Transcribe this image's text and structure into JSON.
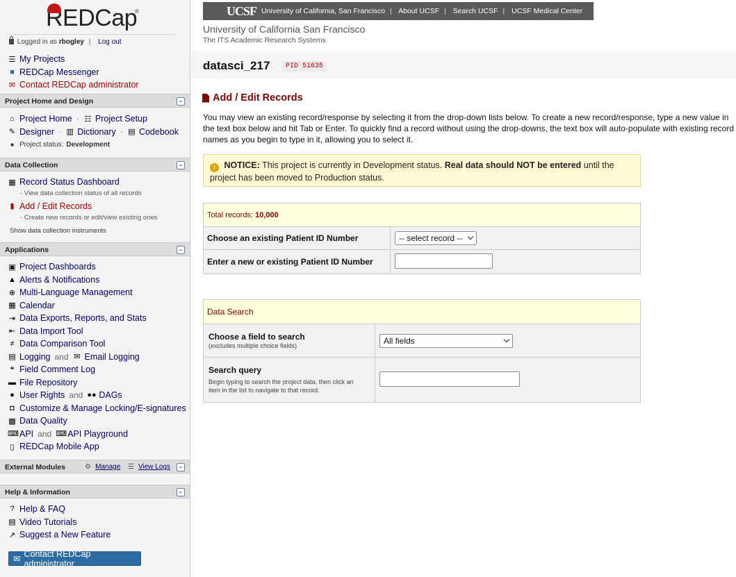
{
  "sidebar": {
    "logo_text": "REDCap",
    "logo_reg": "®",
    "login": {
      "prefix": "Logged in as",
      "user": "rbogley",
      "separator": "|",
      "logout": "Log out"
    },
    "top_links": [
      {
        "icon": "list-icon",
        "label": "My Projects"
      },
      {
        "icon": "chat-icon",
        "label": "REDCap Messenger"
      },
      {
        "icon": "envelope-icon",
        "label": "Contact REDCap administrator"
      }
    ],
    "project_home_design": {
      "title": "Project Home and Design",
      "project_home": "Project Home",
      "project_setup": "Project Setup",
      "designer": "Designer",
      "dictionary": "Dictionary",
      "codebook": "Codebook",
      "status_label": "Project status:",
      "status_value": "Development"
    },
    "data_collection": {
      "title": "Data Collection",
      "record_status": "Record Status Dashboard",
      "record_status_sub": "- View data collection status of all records",
      "add_edit": "Add / Edit Records",
      "add_edit_sub": "- Create new records or edit/view existing ones",
      "show_instruments": "Show data collection instruments"
    },
    "applications": {
      "title": "Applications",
      "and": "and",
      "project_dashboards": "Project Dashboards",
      "alerts": "Alerts & Notifications",
      "mlm": "Multi-Language Management",
      "calendar": "Calendar",
      "exports": "Data Exports, Reports, and Stats",
      "import": "Data Import Tool",
      "comparison": "Data Comparison Tool",
      "logging": "Logging",
      "email_logging": "Email Logging",
      "field_comment": "Field Comment Log",
      "file_repo": "File Repository",
      "user_rights": "User Rights",
      "dags": "DAGs",
      "locking": "Customize & Manage Locking/E-signatures",
      "data_quality": "Data Quality",
      "api": "API",
      "api_playground": "API Playground",
      "mobile_app": "REDCap Mobile App"
    },
    "external_modules": {
      "title": "External Modules",
      "manage": "Manage",
      "view_logs": "View Logs"
    },
    "help": {
      "title": "Help & Information",
      "help_faq": "Help & FAQ",
      "video_tutorials": "Video Tutorials",
      "suggest": "Suggest a New Feature"
    },
    "contact_button": "Contact REDCap administrator"
  },
  "header": {
    "ucsf_logo": "UCSF",
    "ucsf_links": [
      "University of California, San Francisco",
      "About UCSF",
      "Search UCSF",
      "UCSF Medical Center"
    ],
    "institution": "University of California San Francisco",
    "institution_sub": "The ITS Academic Research Systems",
    "project_title": "datasci_217",
    "pid": "PID 51635"
  },
  "main": {
    "heading": "Add / Edit Records",
    "intro": "You may view an existing record/response by selecting it from the drop-down lists below. To create a new record/response, type a new value in the text box below and hit Tab or Enter. To quickly find a record without using the drop-downs, the text box will auto-populate with existing record names as you begin to type in it, allowing you to select it.",
    "notice": {
      "label": "NOTICE:",
      "text1": "This project is currently in Development status.",
      "bold": "Real data should NOT be entered",
      "text2": "until the project has been moved to Production status."
    },
    "records": {
      "total_label": "Total records:",
      "total_value": "10,000",
      "choose_label": "Choose an existing Patient ID Number",
      "choose_select": "-- select record --",
      "enter_label": "Enter a new or existing Patient ID Number",
      "enter_value": ""
    },
    "search": {
      "title": "Data Search",
      "field_label": "Choose a field to search",
      "field_hint": "(excludes multiple choice fields)",
      "field_select": "All fields",
      "query_label": "Search query",
      "query_hint": "Begin typing to search the project data, then click an item in the list to navigate to that record.",
      "query_value": ""
    }
  },
  "colors": {
    "accent_red": "#800000",
    "link_blue": "#000066",
    "button_blue": "#2d6ca2",
    "notice_bg": "#fff9d4"
  }
}
